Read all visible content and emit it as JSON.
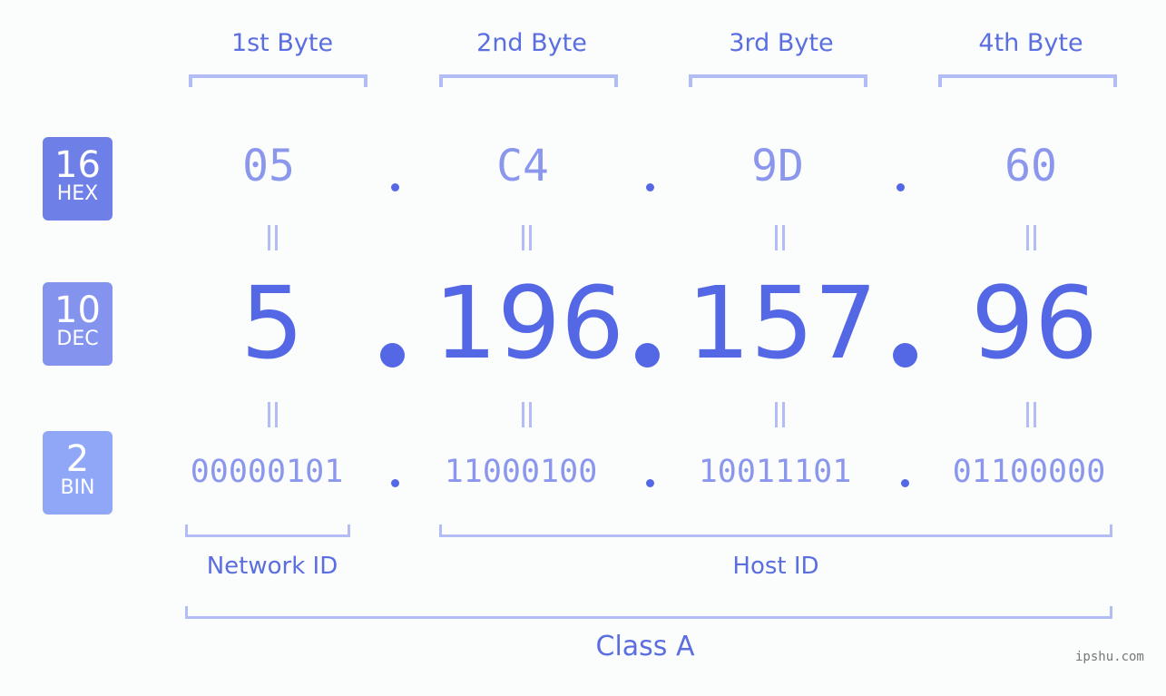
{
  "byte_headers": [
    "1st Byte",
    "2nd Byte",
    "3rd Byte",
    "4th Byte"
  ],
  "badges": [
    {
      "number": "16",
      "label": "HEX",
      "color": "#6f7fe8"
    },
    {
      "number": "10",
      "label": "DEC",
      "color": "#8493ee"
    },
    {
      "number": "2",
      "label": "BIN",
      "color": "#8fa7f6"
    }
  ],
  "hex": [
    "05",
    "C4",
    "9D",
    "60"
  ],
  "dec": [
    "5",
    "196",
    "157",
    "96"
  ],
  "bin": [
    "00000101",
    "11000100",
    "10011101",
    "01100000"
  ],
  "separator": ".",
  "network_id_label": "Network ID",
  "host_id_label": "Host ID",
  "class_label": "Class A",
  "watermark": "ipshu.com",
  "colors": {
    "accent": "#5468e6",
    "light": "#8b97ec",
    "bracket": "#b3bdf5"
  }
}
